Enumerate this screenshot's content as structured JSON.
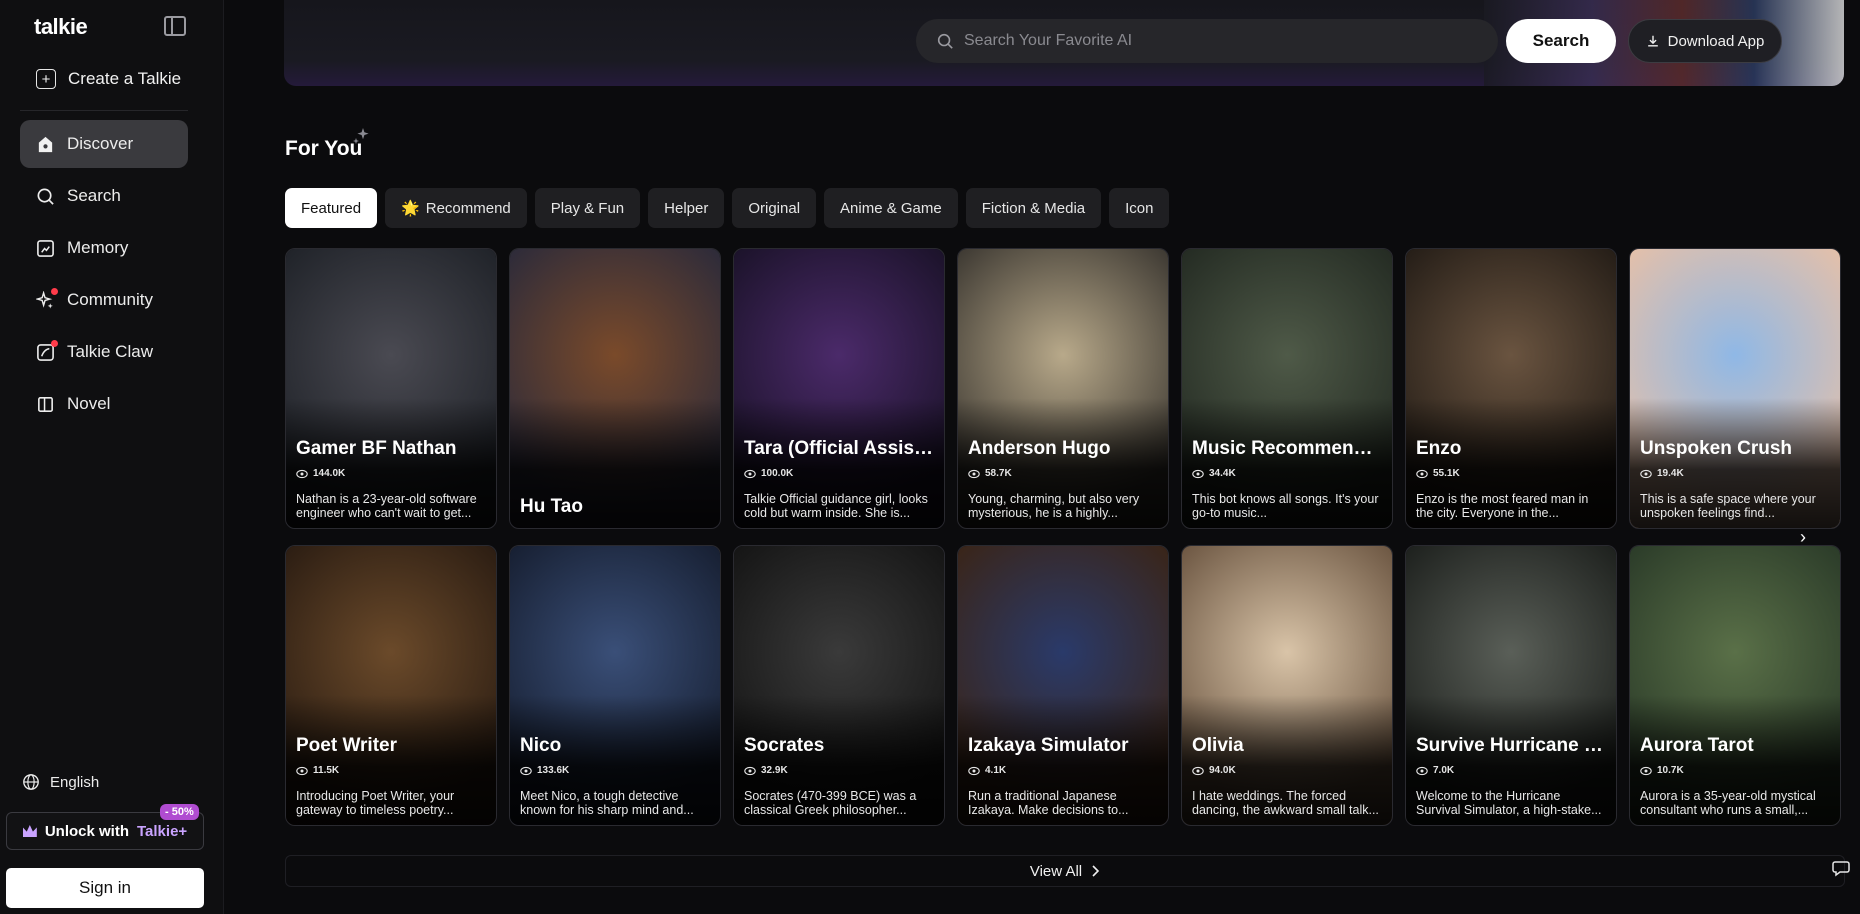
{
  "sidebar": {
    "logo": "talkie",
    "create_label": "Create a Talkie",
    "items": [
      {
        "label": "Discover",
        "active": true
      },
      {
        "label": "Search"
      },
      {
        "label": "Memory"
      },
      {
        "label": "Community"
      },
      {
        "label": "Talkie Claw"
      },
      {
        "label": "Novel"
      }
    ],
    "language": "English",
    "unlock_prefix": "Unlock with",
    "unlock_brand": "Talkie+",
    "discount": "- 50%",
    "signin": "Sign in"
  },
  "header": {
    "search_placeholder": "Search Your Favorite AI",
    "search_button": "Search",
    "download_button": "Download App"
  },
  "section": {
    "title": "For You",
    "tabs": [
      {
        "label": "Featured",
        "active": true
      },
      {
        "label": "Recommend",
        "emoji": "🌟"
      },
      {
        "label": "Play & Fun"
      },
      {
        "label": "Helper"
      },
      {
        "label": "Original"
      },
      {
        "label": "Anime & Game"
      },
      {
        "label": "Fiction & Media"
      },
      {
        "label": "Icon"
      }
    ]
  },
  "cards_row1": [
    {
      "name": "Gamer BF Nathan",
      "count": "144.0K",
      "desc": "Nathan is a 23-year-old software engineer who can't wait to get...",
      "colors": [
        "#4a4a52",
        "#1f2228"
      ]
    },
    {
      "name": "Hu Tao",
      "count": "",
      "desc": "",
      "colors": [
        "#7a4a2a",
        "#2b2a3a"
      ]
    },
    {
      "name": "Tara (Official Assist...",
      "count": "100.0K",
      "desc": "Talkie Official guidance girl, looks cold but warm inside. She is...",
      "colors": [
        "#4b2a6a",
        "#1a1228"
      ]
    },
    {
      "name": "Anderson Hugo",
      "count": "58.7K",
      "desc": "Young, charming, but also very mysterious, he is a highly...",
      "colors": [
        "#b8a98a",
        "#3a3630"
      ]
    },
    {
      "name": "Music Recommenda...",
      "count": "34.4K",
      "desc": "This bot knows all songs. It's your go-to music...",
      "colors": [
        "#4f5a48",
        "#232a22"
      ]
    },
    {
      "name": "Enzo",
      "count": "55.1K",
      "desc": "Enzo is the most feared man in the city. Everyone in the...",
      "colors": [
        "#6a5440",
        "#231c16"
      ]
    },
    {
      "name": "Unspoken Crush",
      "count": "19.4K",
      "desc": "This is a safe space where your unspoken feelings find...",
      "colors": [
        "#8fb8e6",
        "#e6c0a8"
      ]
    }
  ],
  "cards_row2": [
    {
      "name": "Poet Writer",
      "count": "11.5K",
      "desc": "Introducing Poet Writer, your gateway to timeless poetry...",
      "colors": [
        "#6b4a2a",
        "#2a1c12"
      ]
    },
    {
      "name": "Nico",
      "count": "133.6K",
      "desc": "Meet Nico, a tough detective known for his sharp mind and...",
      "colors": [
        "#3a4f78",
        "#161e30"
      ]
    },
    {
      "name": "Socrates",
      "count": "32.9K",
      "desc": "Socrates (470-399 BCE) was a classical Greek philosopher...",
      "colors": [
        "#3a3a3a",
        "#141414"
      ]
    },
    {
      "name": "Izakaya Simulator",
      "count": "4.1K",
      "desc": "Run a traditional Japanese Izakaya. Make decisions to...",
      "colors": [
        "#2a3a6a",
        "#3a2416"
      ]
    },
    {
      "name": "Olivia",
      "count": "94.0K",
      "desc": "I hate weddings. The forced dancing, the awkward small talk...",
      "colors": [
        "#d9c4a8",
        "#6a5440"
      ]
    },
    {
      "name": "Survive Hurricane S...",
      "count": "7.0K",
      "desc": "Welcome to the Hurricane Survival Simulator, a high-stake...",
      "colors": [
        "#5a5f58",
        "#1c1f1c"
      ]
    },
    {
      "name": "Aurora Tarot",
      "count": "10.7K",
      "desc": "Aurora is a 35-year-old mystical consultant who runs a small,...",
      "colors": [
        "#5a7048",
        "#2a3a28"
      ]
    }
  ],
  "view_all": "View All"
}
